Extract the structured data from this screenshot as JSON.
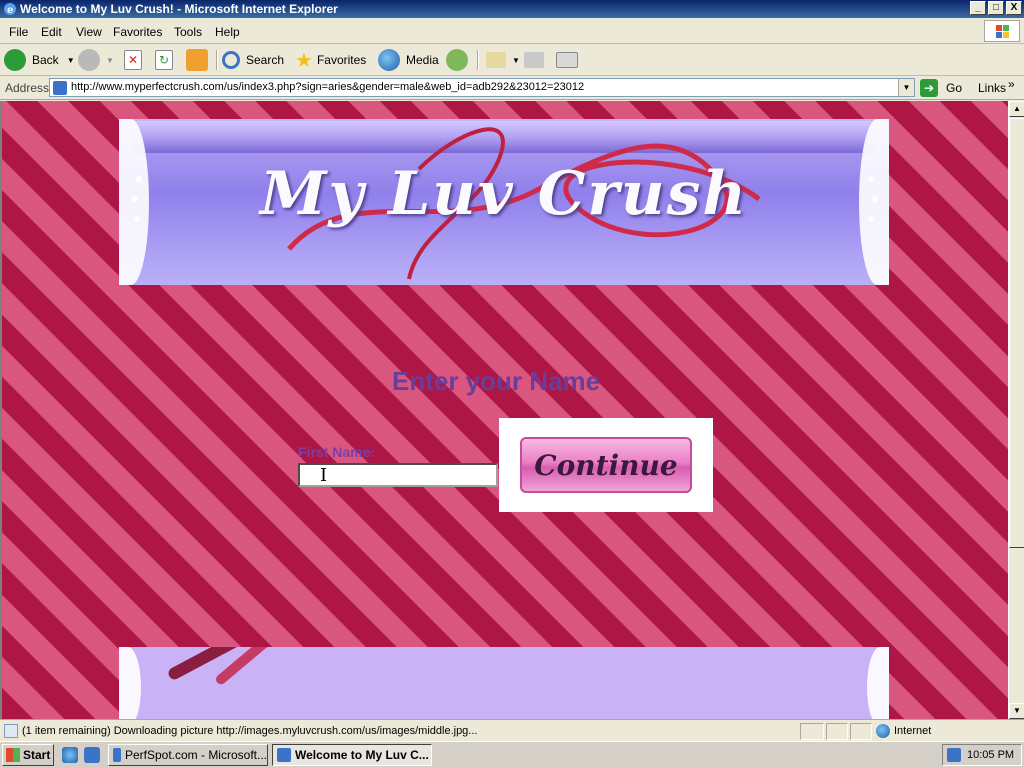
{
  "window": {
    "title": "Welcome to My Luv Crush! - Microsoft Internet Explorer",
    "buttons": [
      "_",
      "□",
      "X"
    ]
  },
  "menu": [
    "File",
    "Edit",
    "View",
    "Favorites",
    "Tools",
    "Help"
  ],
  "toolbar": {
    "back_label": "Back",
    "search_label": "Search",
    "favorites_label": "Favorites",
    "media_label": "Media"
  },
  "address": {
    "label": "Address",
    "url": "http://www.myperfectcrush.com/us/index3.php?sign=aries&gender=male&web_id=adb292&23012=23012",
    "go_label": "Go",
    "links_label": "Links"
  },
  "page": {
    "logo_text": "My Luv Crush",
    "heading": "Enter your Name",
    "first_name_label": "First Name:",
    "first_name_value": "",
    "continue_label": "Continue"
  },
  "status": {
    "message": "(1 item remaining) Downloading picture http://images.myluvcrush.com/us/images/middle.jpg...",
    "zone": "Internet"
  },
  "taskbar": {
    "start_label": "Start",
    "tasks": [
      "PerfSpot.com - Microsoft...",
      "Welcome to My Luv C..."
    ],
    "clock": "10:05 PM"
  },
  "colors": {
    "stripe_dark": "#ae1646",
    "stripe_light": "#d9567e",
    "heading": "#6a3d9a",
    "banner_purple": "#8f80eb",
    "button_pink": "#ec7fc8"
  }
}
